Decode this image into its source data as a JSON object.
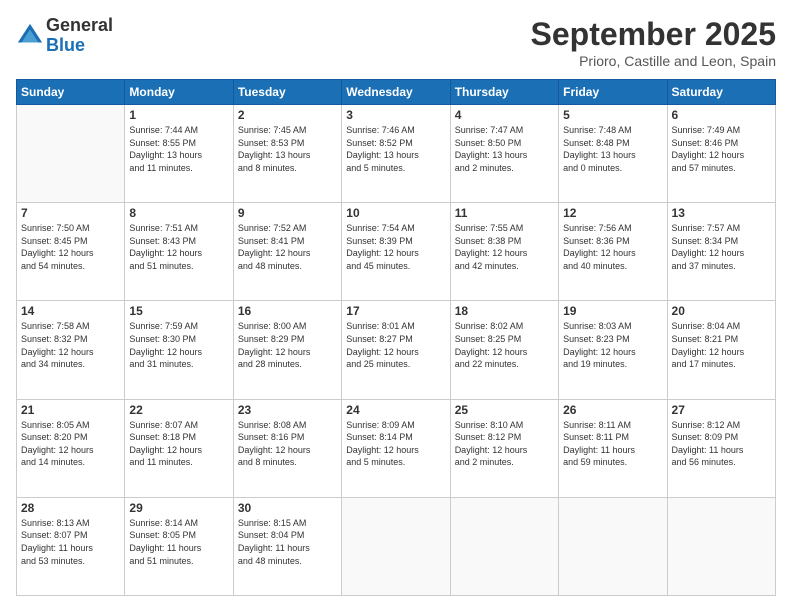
{
  "logo": {
    "general": "General",
    "blue": "Blue"
  },
  "title": "September 2025",
  "location": "Prioro, Castille and Leon, Spain",
  "days_header": [
    "Sunday",
    "Monday",
    "Tuesday",
    "Wednesday",
    "Thursday",
    "Friday",
    "Saturday"
  ],
  "weeks": [
    [
      {
        "day": "",
        "info": ""
      },
      {
        "day": "1",
        "info": "Sunrise: 7:44 AM\nSunset: 8:55 PM\nDaylight: 13 hours\nand 11 minutes."
      },
      {
        "day": "2",
        "info": "Sunrise: 7:45 AM\nSunset: 8:53 PM\nDaylight: 13 hours\nand 8 minutes."
      },
      {
        "day": "3",
        "info": "Sunrise: 7:46 AM\nSunset: 8:52 PM\nDaylight: 13 hours\nand 5 minutes."
      },
      {
        "day": "4",
        "info": "Sunrise: 7:47 AM\nSunset: 8:50 PM\nDaylight: 13 hours\nand 2 minutes."
      },
      {
        "day": "5",
        "info": "Sunrise: 7:48 AM\nSunset: 8:48 PM\nDaylight: 13 hours\nand 0 minutes."
      },
      {
        "day": "6",
        "info": "Sunrise: 7:49 AM\nSunset: 8:46 PM\nDaylight: 12 hours\nand 57 minutes."
      }
    ],
    [
      {
        "day": "7",
        "info": "Sunrise: 7:50 AM\nSunset: 8:45 PM\nDaylight: 12 hours\nand 54 minutes."
      },
      {
        "day": "8",
        "info": "Sunrise: 7:51 AM\nSunset: 8:43 PM\nDaylight: 12 hours\nand 51 minutes."
      },
      {
        "day": "9",
        "info": "Sunrise: 7:52 AM\nSunset: 8:41 PM\nDaylight: 12 hours\nand 48 minutes."
      },
      {
        "day": "10",
        "info": "Sunrise: 7:54 AM\nSunset: 8:39 PM\nDaylight: 12 hours\nand 45 minutes."
      },
      {
        "day": "11",
        "info": "Sunrise: 7:55 AM\nSunset: 8:38 PM\nDaylight: 12 hours\nand 42 minutes."
      },
      {
        "day": "12",
        "info": "Sunrise: 7:56 AM\nSunset: 8:36 PM\nDaylight: 12 hours\nand 40 minutes."
      },
      {
        "day": "13",
        "info": "Sunrise: 7:57 AM\nSunset: 8:34 PM\nDaylight: 12 hours\nand 37 minutes."
      }
    ],
    [
      {
        "day": "14",
        "info": "Sunrise: 7:58 AM\nSunset: 8:32 PM\nDaylight: 12 hours\nand 34 minutes."
      },
      {
        "day": "15",
        "info": "Sunrise: 7:59 AM\nSunset: 8:30 PM\nDaylight: 12 hours\nand 31 minutes."
      },
      {
        "day": "16",
        "info": "Sunrise: 8:00 AM\nSunset: 8:29 PM\nDaylight: 12 hours\nand 28 minutes."
      },
      {
        "day": "17",
        "info": "Sunrise: 8:01 AM\nSunset: 8:27 PM\nDaylight: 12 hours\nand 25 minutes."
      },
      {
        "day": "18",
        "info": "Sunrise: 8:02 AM\nSunset: 8:25 PM\nDaylight: 12 hours\nand 22 minutes."
      },
      {
        "day": "19",
        "info": "Sunrise: 8:03 AM\nSunset: 8:23 PM\nDaylight: 12 hours\nand 19 minutes."
      },
      {
        "day": "20",
        "info": "Sunrise: 8:04 AM\nSunset: 8:21 PM\nDaylight: 12 hours\nand 17 minutes."
      }
    ],
    [
      {
        "day": "21",
        "info": "Sunrise: 8:05 AM\nSunset: 8:20 PM\nDaylight: 12 hours\nand 14 minutes."
      },
      {
        "day": "22",
        "info": "Sunrise: 8:07 AM\nSunset: 8:18 PM\nDaylight: 12 hours\nand 11 minutes."
      },
      {
        "day": "23",
        "info": "Sunrise: 8:08 AM\nSunset: 8:16 PM\nDaylight: 12 hours\nand 8 minutes."
      },
      {
        "day": "24",
        "info": "Sunrise: 8:09 AM\nSunset: 8:14 PM\nDaylight: 12 hours\nand 5 minutes."
      },
      {
        "day": "25",
        "info": "Sunrise: 8:10 AM\nSunset: 8:12 PM\nDaylight: 12 hours\nand 2 minutes."
      },
      {
        "day": "26",
        "info": "Sunrise: 8:11 AM\nSunset: 8:11 PM\nDaylight: 11 hours\nand 59 minutes."
      },
      {
        "day": "27",
        "info": "Sunrise: 8:12 AM\nSunset: 8:09 PM\nDaylight: 11 hours\nand 56 minutes."
      }
    ],
    [
      {
        "day": "28",
        "info": "Sunrise: 8:13 AM\nSunset: 8:07 PM\nDaylight: 11 hours\nand 53 minutes."
      },
      {
        "day": "29",
        "info": "Sunrise: 8:14 AM\nSunset: 8:05 PM\nDaylight: 11 hours\nand 51 minutes."
      },
      {
        "day": "30",
        "info": "Sunrise: 8:15 AM\nSunset: 8:04 PM\nDaylight: 11 hours\nand 48 minutes."
      },
      {
        "day": "",
        "info": ""
      },
      {
        "day": "",
        "info": ""
      },
      {
        "day": "",
        "info": ""
      },
      {
        "day": "",
        "info": ""
      }
    ]
  ]
}
